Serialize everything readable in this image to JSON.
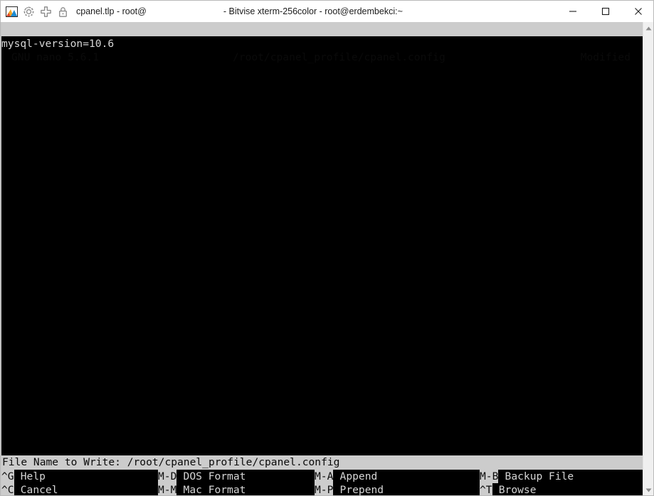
{
  "window": {
    "title_left": "cpanel.tlp - root@",
    "title_right": "- Bitvise xterm-256color - root@erdembekci:~",
    "icons": {
      "app": "bitvise-logo-icon",
      "gear": "gear-icon",
      "plus": "new-window-icon",
      "lock": "lock-icon"
    },
    "controls": {
      "minimize": "minimize-icon",
      "maximize": "maximize-icon",
      "close": "close-icon"
    }
  },
  "editor": {
    "header": {
      "version": "GNU nano 5.6.1",
      "filepath": "/root/cpanel_profile/cpanel.config",
      "status": "Modified"
    },
    "buffer": {
      "lines": [
        "mysql-version=10.6"
      ]
    },
    "prompt": {
      "label": "File Name to Write:",
      "value": "/root/cpanel_profile/cpanel.config",
      "full": "File Name to Write: /root/cpanel_profile/cpanel.config"
    },
    "shortcuts": {
      "row1": [
        {
          "key": "^G",
          "label": "Help"
        },
        {
          "key": "M-D",
          "label": "DOS Format"
        },
        {
          "key": "M-A",
          "label": "Append"
        },
        {
          "key": "M-B",
          "label": "Backup File"
        }
      ],
      "row2": [
        {
          "key": "^C",
          "label": "Cancel"
        },
        {
          "key": "M-M",
          "label": "Mac Format"
        },
        {
          "key": "M-P",
          "label": "Prepend"
        },
        {
          "key": "^T",
          "label": "Browse"
        }
      ]
    }
  },
  "scrollbar": {
    "up_icon": "scroll-up-arrow-icon",
    "down_icon": "scroll-down-arrow-icon"
  },
  "colors": {
    "terminal_bg": "#000000",
    "terminal_fg": "#d6d6d6",
    "inverted_bg": "#cccccc",
    "inverted_fg": "#0a0a0a",
    "titlebar_bg": "#ffffff"
  }
}
